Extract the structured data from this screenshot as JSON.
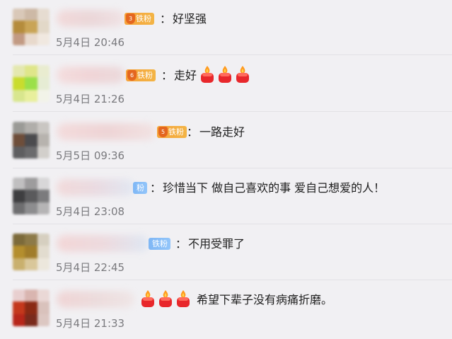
{
  "comments": [
    {
      "badge_level": "3",
      "badge_label": "铁粉",
      "badge_style": "gold",
      "colon": "：",
      "text": "好坚强",
      "candle_count": 0,
      "time": "5月4日 20:46"
    },
    {
      "badge_level": "6",
      "badge_label": "铁粉",
      "badge_style": "gold",
      "colon": "：",
      "text": "走好",
      "candle_count": 3,
      "time": "5月4日 21:26"
    },
    {
      "badge_level": "5",
      "badge_label": "铁粉",
      "badge_style": "gold",
      "colon": "：",
      "text": "一路走好",
      "candle_count": 0,
      "time": "5月5日 09:36"
    },
    {
      "badge_level": "",
      "badge_label": "粉",
      "badge_style": "blue",
      "colon": "：",
      "text": "珍惜当下 做自己喜欢的事 爱自己想爱的人！",
      "candle_count": 0,
      "time": "5月4日 23:08"
    },
    {
      "badge_level": "",
      "badge_label": "铁粉",
      "badge_style": "blue",
      "colon": "：",
      "text": "不用受罪了",
      "candle_count": 0,
      "time": "5月4日 22:45"
    },
    {
      "badge_level": "",
      "badge_label": "",
      "badge_style": "none",
      "colon": "",
      "text": "希望下辈子没有病痛折磨。",
      "candle_count": 3,
      "time": "5月4日 21:33"
    }
  ],
  "icons": {
    "candle": "candle-emoji-icon",
    "level_badge": "level-badge-icon"
  },
  "colors": {
    "background": "#f1f0f3",
    "text": "#1e1e1e",
    "time": "#7a7a7e",
    "badge_gold": "#f6a33a",
    "badge_blue": "#7fb7f5",
    "candle_red": "#e8272b",
    "flame": "#ff9a1f"
  }
}
